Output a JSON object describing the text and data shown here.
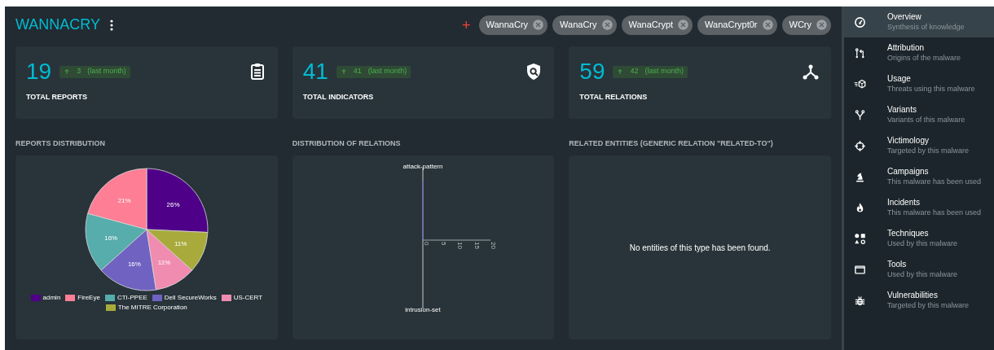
{
  "header": {
    "title": "WANNACRY",
    "add_icon": "+",
    "aliases": [
      "WannaCry",
      "WanaCry",
      "WanaCrypt",
      "WanaCrypt0r",
      "WCry"
    ]
  },
  "stats": [
    {
      "kind": "reports",
      "value": "19",
      "delta": "3",
      "period": "(last month)",
      "label": "TOTAL REPORTS"
    },
    {
      "kind": "indicators",
      "value": "41",
      "delta": "41",
      "period": "(last month)",
      "label": "TOTAL INDICATORS"
    },
    {
      "kind": "relations",
      "value": "59",
      "delta": "42",
      "period": "(last month)",
      "label": "TOTAL RELATIONS"
    }
  ],
  "reports_distribution": {
    "title": "REPORTS DISTRIBUTION",
    "chart_data": {
      "type": "pie",
      "categories": [
        "admin",
        "FireEye",
        "CTI-PPEE",
        "Dell SecureWorks",
        "US-CERT",
        "The MITRE Corporation"
      ],
      "values": [
        26,
        21,
        16,
        16,
        11,
        11
      ],
      "colors": [
        "#4f0088",
        "#fd7e95",
        "#56adab",
        "#6f62c1",
        "#f08cb0",
        "#a8ab3c"
      ],
      "value_labels": [
        "26%",
        "21%",
        "16%",
        "16%",
        "11%",
        "11%"
      ]
    }
  },
  "relations_distribution": {
    "title": "DISTRIBUTION OF RELATIONS",
    "axis_labels": [
      "attack-pattern",
      "intrusion-set"
    ],
    "ticks": [
      "0",
      "5",
      "10",
      "15",
      "20"
    ]
  },
  "related_entities": {
    "title": "RELATED ENTITIES (GENERIC RELATION \"RELATED-TO\")",
    "empty_message": "No entities of this type has been found."
  },
  "sidebar": {
    "items": [
      {
        "kind": "overview",
        "label": "Overview",
        "description": "Synthesis of knowledge",
        "selected": true
      },
      {
        "kind": "attribution",
        "label": "Attribution",
        "description": "Origins of the malware",
        "selected": false
      },
      {
        "kind": "usage",
        "label": "Usage",
        "description": "Threats using this malware",
        "selected": false
      },
      {
        "kind": "variants",
        "label": "Variants",
        "description": "Variants of this malware",
        "selected": false
      },
      {
        "kind": "victimology",
        "label": "Victimology",
        "description": "Targeted by this malware",
        "selected": false
      },
      {
        "kind": "campaigns",
        "label": "Campaigns",
        "description": "This malware has been used",
        "selected": false
      },
      {
        "kind": "incidents",
        "label": "Incidents",
        "description": "This malware has been used",
        "selected": false
      },
      {
        "kind": "techniques",
        "label": "Techniques",
        "description": "Used by this malware",
        "selected": false
      },
      {
        "kind": "tools",
        "label": "Tools",
        "description": "Used by this malware",
        "selected": false
      },
      {
        "kind": "vulnerabilities",
        "label": "Vulnerabilities",
        "description": "Targeted by this malware",
        "selected": false
      }
    ]
  }
}
